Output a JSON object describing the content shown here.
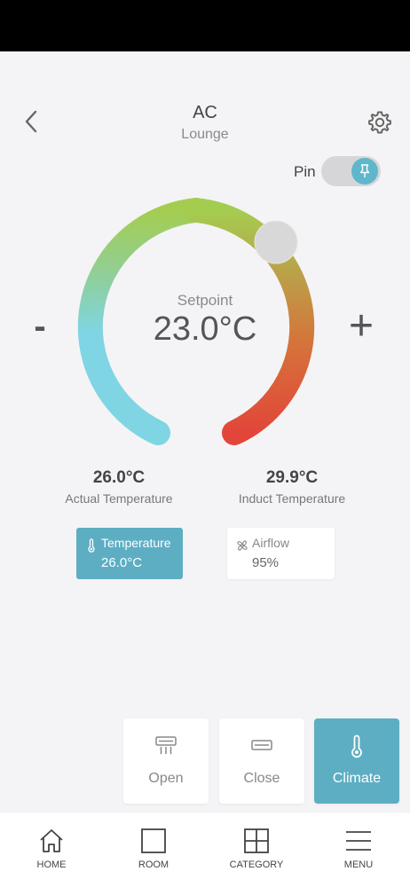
{
  "header": {
    "title": "AC",
    "subtitle": "Lounge",
    "back_icon": "chevron-left-icon",
    "settings_icon": "gear-icon"
  },
  "pin": {
    "label": "Pin",
    "enabled": true,
    "icon": "pin-icon"
  },
  "setpoint": {
    "label": "Setpoint",
    "value": "23.0°C",
    "decrease_label": "-",
    "increase_label": "+",
    "gradient_colors": [
      "#7fd5e3",
      "#8fcf9a",
      "#a4cd50",
      "#b8a64a",
      "#d5733a",
      "#e2463a"
    ],
    "knob_color": "#d8d8d8"
  },
  "readings": [
    {
      "value": "26.0°C",
      "label": "Actual Temperature"
    },
    {
      "value": "29.9°C",
      "label": "Induct Temperature"
    }
  ],
  "cards": [
    {
      "label": "Temperature",
      "value": "26.0°C",
      "icon": "thermometer-icon",
      "active": true
    },
    {
      "label": "Airflow",
      "value": "95%",
      "icon": "fan-icon",
      "active": false
    }
  ],
  "actions": [
    {
      "label": "Open",
      "icon": "vent-open-icon",
      "active": false
    },
    {
      "label": "Close",
      "icon": "vent-close-icon",
      "active": false
    },
    {
      "label": "Climate",
      "icon": "thermometer-icon",
      "active": true
    }
  ],
  "nav": [
    {
      "label": "HOME",
      "icon": "home-icon"
    },
    {
      "label": "ROOM",
      "icon": "square-icon"
    },
    {
      "label": "CATEGORY",
      "icon": "grid-icon"
    },
    {
      "label": "MENU",
      "icon": "menu-icon"
    }
  ],
  "colors": {
    "accent": "#5daec3",
    "background": "#f4f4f6"
  }
}
